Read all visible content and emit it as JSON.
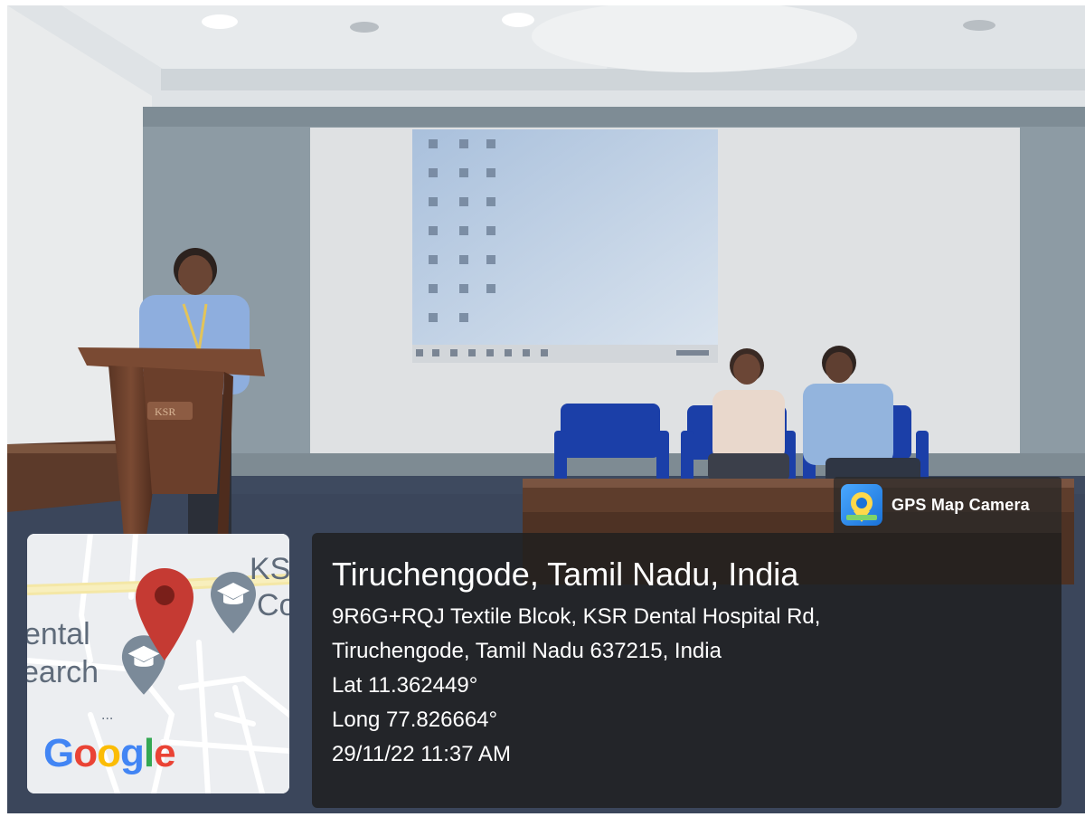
{
  "gps_badge": {
    "app_name": "GPS Map Camera",
    "icon": "camera-location-icon"
  },
  "location": {
    "title": "Tiruchengode, Tamil Nadu, India",
    "address_line1": "9R6G+RQJ Textile Blcok, KSR Dental Hospital Rd,",
    "address_line2": "Tiruchengode, Tamil Nadu 637215, India",
    "latitude": "Lat 11.362449°",
    "longitude": "Long 77.826664°",
    "datetime": "29/11/22 11:37 AM"
  },
  "map": {
    "labels": {
      "ks": "KS",
      "co": "Co",
      "dental": "ental",
      "search": "earch"
    },
    "logo_text": "Google",
    "pin_icon": "map-pin-icon",
    "school_icon": "graduation-cap-icon"
  },
  "podium": {
    "logo_text": "KSR"
  },
  "colors": {
    "panel_bg": "#1e1e1e",
    "pin_red": "#c53a33",
    "google_blue": "#4285F4",
    "google_red": "#EA4335",
    "google_yellow": "#FBBC05",
    "google_green": "#34A853"
  }
}
